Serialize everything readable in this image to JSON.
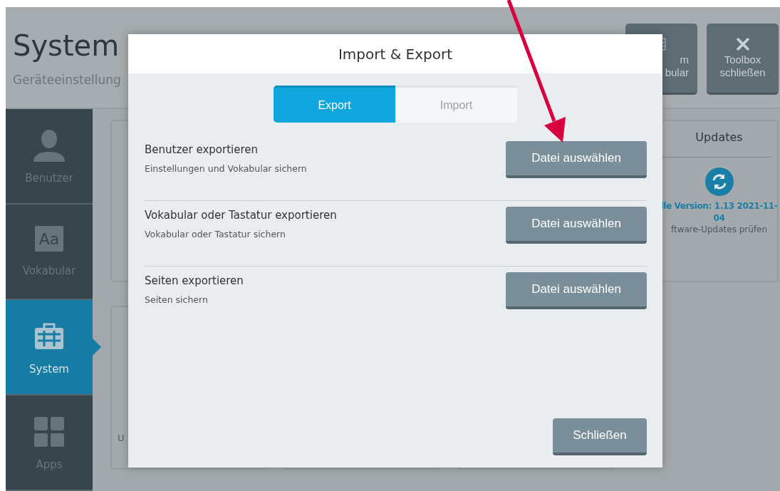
{
  "app": {
    "title": "System",
    "subtitle": "Geräteeinstellung",
    "header_buttons": [
      {
        "kind": "grid",
        "lines": [
          "m",
          "bular"
        ]
      },
      {
        "kind": "close",
        "lines": [
          "Toolbox",
          "schließen"
        ]
      }
    ]
  },
  "sidebar": {
    "items": [
      {
        "label": "Benutzer",
        "kind": "user",
        "selected": false
      },
      {
        "label": "Vokabular",
        "kind": "letters",
        "icon_text": "Aa",
        "selected": false
      },
      {
        "label": "System",
        "kind": "toolbox",
        "selected": true
      },
      {
        "label": "Apps",
        "kind": "apps",
        "selected": false
      }
    ]
  },
  "cards": {
    "first_card_text": "U",
    "updates": {
      "title": "Updates",
      "version": "lle Version: 1.13 2021-11-04",
      "hint": "ftware-Updates prüfen"
    }
  },
  "dialog": {
    "title": "Import & Export",
    "tabs": [
      {
        "label": "Export",
        "selected": true
      },
      {
        "label": "Import",
        "selected": false
      }
    ],
    "rows": [
      {
        "title": "Benutzer exportieren",
        "description": "Einstellungen und Vokabular sichern",
        "button": "Datei auswählen"
      },
      {
        "title": "Vokabular oder Tastatur exportieren",
        "description": "Vokabular oder Tastatur sichern",
        "button": "Datei auswählen"
      },
      {
        "title": "Seiten exportieren",
        "description": "Seiten sichern",
        "button": "Datei auswählen"
      }
    ],
    "close_button": "Schließen"
  }
}
